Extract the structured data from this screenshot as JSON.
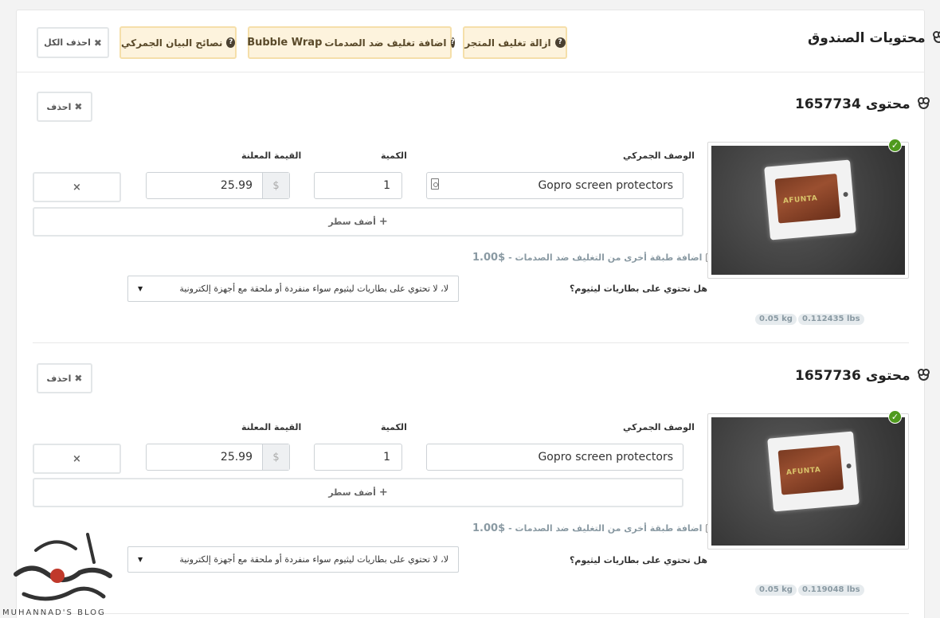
{
  "header": {
    "title": "محتويات الصندوق",
    "buttons": {
      "delete_all": "احذف الكل",
      "customs_tips": "نصائح البيان الجمركي",
      "bubble_pre": "اضافة تغليف ضد الصدمات",
      "bubble_brand": "Bubble Wrap",
      "remove_packaging": "ازالة تغليف المتجر"
    }
  },
  "items": [
    {
      "title": "محتوى 1657734",
      "delete_label": "احذف",
      "labels": {
        "description": "الوصف الجمركي",
        "quantity": "الكمية",
        "value": "القيمة المعلنة"
      },
      "description": "Gopro screen protectors",
      "quantity": "1",
      "currency": "$",
      "value": "25.99",
      "remove_row": "×",
      "add_row": "أضف سطر",
      "add_row_icon": "+",
      "extra_layer": "اضافة طبقة أخرى من التغليف ضد الصدمات -",
      "extra_layer_price": "1.00$",
      "battery_question": "هل تحتوي على بطاريات ليثيوم؟",
      "battery_answer": "لا، لا تحتوي على بطاريات ليثيوم سواء منفردة أو ملحقة مع أجهزة إلكترونية",
      "product_logo": "AFUNTA",
      "weight_kg": "0.05 kg",
      "weight_lbs": "0.112435 lbs",
      "verified": "✓"
    },
    {
      "title": "محتوى 1657736",
      "delete_label": "احذف",
      "labels": {
        "description": "الوصف الجمركي",
        "quantity": "الكمية",
        "value": "القيمة المعلنة"
      },
      "description": "Gopro screen protectors",
      "quantity": "1",
      "currency": "$",
      "value": "25.99",
      "remove_row": "×",
      "add_row": "أضف سطر",
      "add_row_icon": "+",
      "extra_layer": "اضافة طبقة أخرى من التغليف ضد الصدمات -",
      "extra_layer_price": "1.00$",
      "battery_question": "هل تحتوي على بطاريات ليثيوم؟",
      "battery_answer": "لا، لا تحتوي على بطاريات ليثيوم سواء منفردة أو ملحقة مع أجهزة إلكترونية",
      "product_logo": "AFUNTA",
      "weight_kg": "0.05 kg",
      "weight_lbs": "0.119048 lbs",
      "verified": "✓"
    }
  ],
  "watermark": {
    "caption": "MUHANNAD'S BLOG"
  },
  "icons": {
    "bear": "bear-icon",
    "question": "question-icon",
    "close": "close-icon",
    "plus": "plus-icon",
    "check": "check-icon",
    "document": "document-icon",
    "caret": "caret-down-icon"
  },
  "colors": {
    "warn_bg": "#fdf3dd",
    "check_green": "#4f9a1e",
    "muted": "#8a9aa3"
  }
}
